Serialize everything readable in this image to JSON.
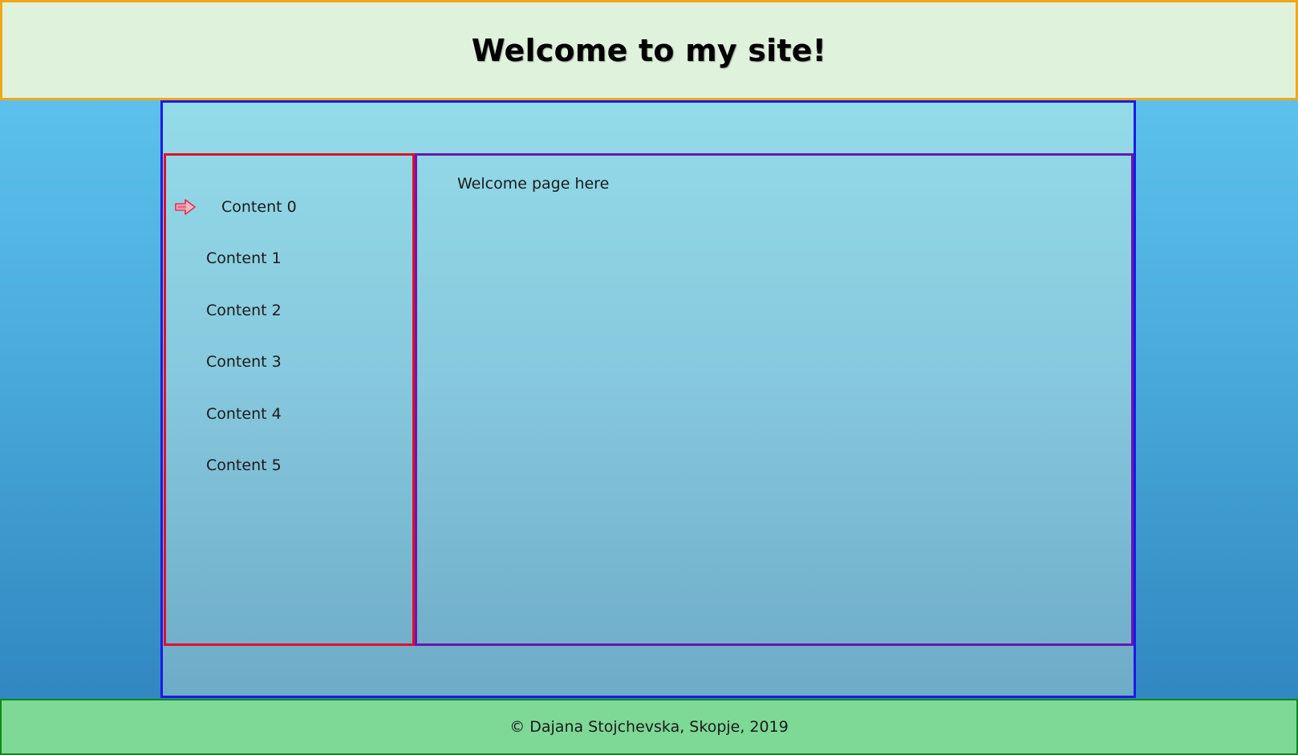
{
  "header": {
    "title": "Welcome to my site!"
  },
  "sidebar": {
    "selected_icon": "arrow-right-icon",
    "items": [
      {
        "label": "Content 0"
      },
      {
        "label": "Content 1"
      },
      {
        "label": "Content 2"
      },
      {
        "label": "Content 3"
      },
      {
        "label": "Content 4"
      },
      {
        "label": "Content 5"
      }
    ]
  },
  "main": {
    "text": "Welcome page here"
  },
  "footer": {
    "text": "© Dajana Stojchevska, Skopje, 2019"
  },
  "colors": {
    "header_border": "#f0a71a",
    "header_bg": "#dff2dc",
    "wrapper_border": "#1a1ae6",
    "sidebar_border": "#e0102a",
    "content_border": "#6a16b0",
    "footer_border": "#0d8a1a",
    "footer_bg": "#7ed896",
    "arrow": "#e03050"
  }
}
